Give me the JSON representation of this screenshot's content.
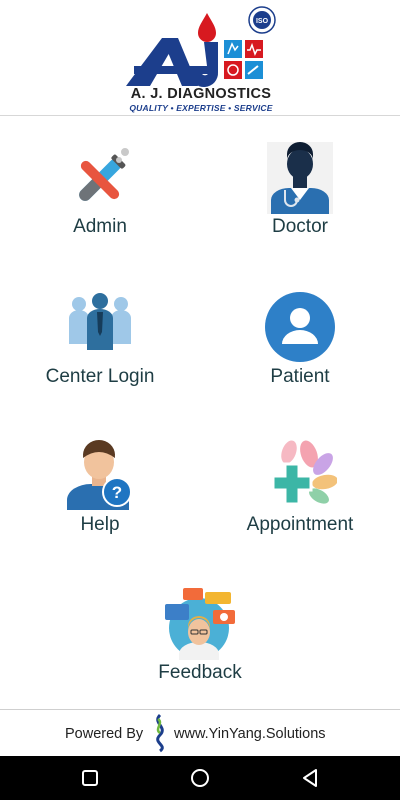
{
  "brand": {
    "name": "A. J. DIAGNOSTICS",
    "tagline": "QUALITY • EXPERTISE • SERVICE",
    "logo_letters": "AJ",
    "badge_text": "ISO",
    "brand_color": "#1c3e8c",
    "accent_color": "#d71920"
  },
  "menu": {
    "admin": {
      "label": "Admin",
      "icon": "test-tube-icon"
    },
    "doctor": {
      "label": "Doctor",
      "icon": "doctor-icon"
    },
    "center_login": {
      "label": "Center Login",
      "icon": "group-icon"
    },
    "patient": {
      "label": "Patient",
      "icon": "user-circle-icon"
    },
    "help": {
      "label": "Help",
      "icon": "help-person-icon"
    },
    "appointment": {
      "label": "Appointment",
      "icon": "medical-cross-icon"
    },
    "feedback": {
      "label": "Feedback",
      "icon": "feedback-icon"
    }
  },
  "footer": {
    "powered_by": "Powered By",
    "site": "www.YinYang.Solutions"
  },
  "navbar": {
    "recents": "recents-square-icon",
    "home": "home-circle-icon",
    "back": "back-triangle-icon"
  }
}
